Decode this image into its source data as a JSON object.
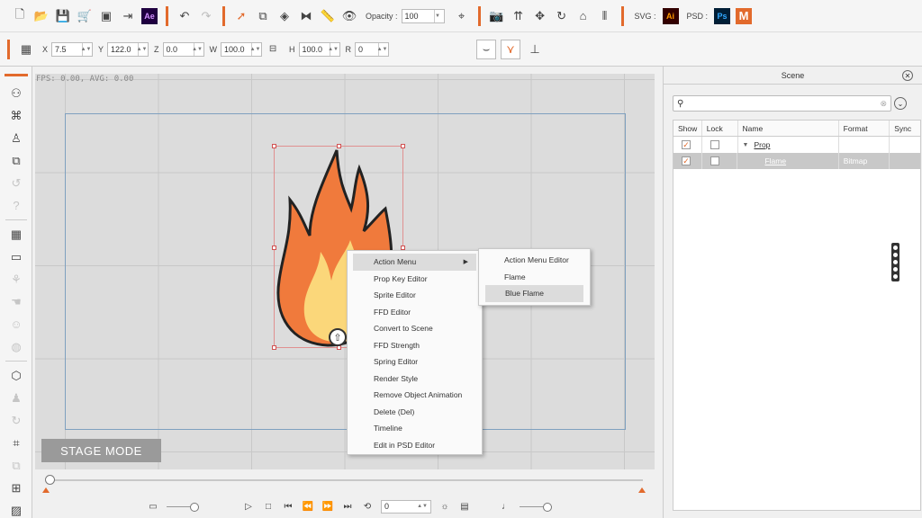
{
  "toolbar": {
    "opacity_label": "Opacity :",
    "opacity_value": "100",
    "svg_label": "SVG :",
    "psd_label": "PSD :",
    "ae_badge": "Ae",
    "ai_badge": "Ai",
    "ps_badge": "Ps",
    "m_badge": "M"
  },
  "transform": {
    "x_label": "X",
    "x_value": "7.5",
    "y_label": "Y",
    "y_value": "122.0",
    "z_label": "Z",
    "z_value": "0.0",
    "w_label": "W",
    "w_value": "100.0",
    "h_label": "H",
    "h_value": "100.0",
    "r_label": "R",
    "r_value": "0"
  },
  "stage": {
    "fps_text": "FPS: 0.00, AVG: 0.00",
    "mode_label": "STAGE MODE"
  },
  "context_menu": {
    "items": [
      "Action Menu",
      "Prop Key Editor",
      "Sprite Editor",
      "FFD Editor",
      "Convert to Scene",
      "FFD Strength",
      "Spring Editor",
      "Render Style",
      "Remove Object Animation",
      "Delete (Del)",
      "Timeline",
      "Edit in PSD Editor"
    ],
    "submenu": [
      "Action Menu Editor",
      "Flame",
      "Blue Flame"
    ]
  },
  "timeline": {
    "frame_value": "0"
  },
  "scene": {
    "title": "Scene",
    "search_placeholder": "",
    "columns": [
      "Show",
      "Lock",
      "Name",
      "Format",
      "Sync"
    ],
    "rows": [
      {
        "name": "Prop",
        "format": ""
      },
      {
        "name": "Flame",
        "format": "Bitmap"
      }
    ]
  },
  "colors": {
    "accent": "#e26a2c",
    "flame_outer": "#f07a3c",
    "flame_inner": "#fbd77a"
  }
}
